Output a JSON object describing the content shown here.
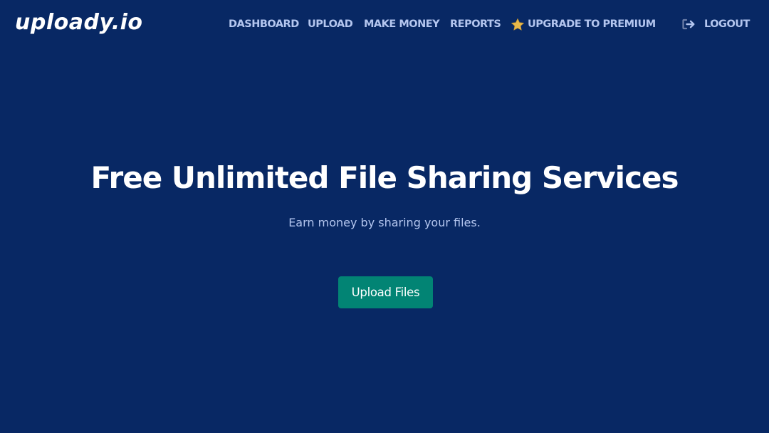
{
  "brand": {
    "logo_text": "uploady.io"
  },
  "nav": {
    "items": [
      {
        "label": "DASHBOARD"
      },
      {
        "label": "UPLOAD"
      },
      {
        "label": "MAKE MONEY"
      },
      {
        "label": "REPORTS"
      },
      {
        "label": "UPGRADE TO PREMIUM",
        "icon": "star-icon"
      },
      {
        "label": "LOGOUT",
        "icon": "logout-icon"
      }
    ]
  },
  "hero": {
    "title": "Free Unlimited File Sharing Services",
    "subtitle": "Earn money by sharing your files.",
    "cta_label": "Upload Files"
  },
  "colors": {
    "background": "#082864",
    "nav_text": "#b4c6ef",
    "cta": "#028474",
    "star": "#e8b84a"
  }
}
